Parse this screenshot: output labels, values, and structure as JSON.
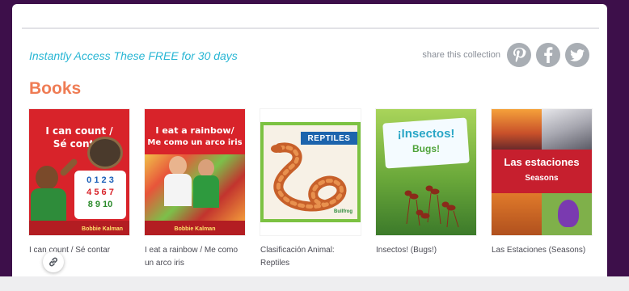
{
  "header": {
    "tagline": "Instantly Access These FREE for 30 days",
    "share_label": "share this collection",
    "social_icons": [
      "pinterest-icon",
      "facebook-icon",
      "twitter-icon"
    ]
  },
  "section": {
    "title": "Books"
  },
  "books": [
    {
      "title": "I can count / Sé contar",
      "cover_lines": [
        "I can count /",
        "Sé contar"
      ],
      "cover_digits": [
        "0 1 2 3",
        "4 5 6 7",
        "8 9 10"
      ],
      "cover_author": "Bobbie Kalman"
    },
    {
      "title": "I eat a rainbow / Me como un arco iris",
      "cover_lines": [
        "I eat a rainbow/",
        "Me como un arco iris"
      ],
      "cover_author": "Bobbie Kalman"
    },
    {
      "title": "Clasificación Animal: Reptiles",
      "cover_banner": "REPTILES",
      "cover_publisher": "Bullfrog"
    },
    {
      "title": "Insectos! (Bugs!)",
      "cover_lines": [
        "¡Insectos!",
        "Bugs!"
      ]
    },
    {
      "title": "Las Estaciones (Seasons)",
      "cover_lines": [
        "Las estaciones",
        "Seasons"
      ]
    }
  ],
  "colors": {
    "page_background": "#3d0f4a",
    "tagline": "#28b6d4",
    "section_title": "#ef7c54",
    "social_icon": "#a9aeb4"
  }
}
